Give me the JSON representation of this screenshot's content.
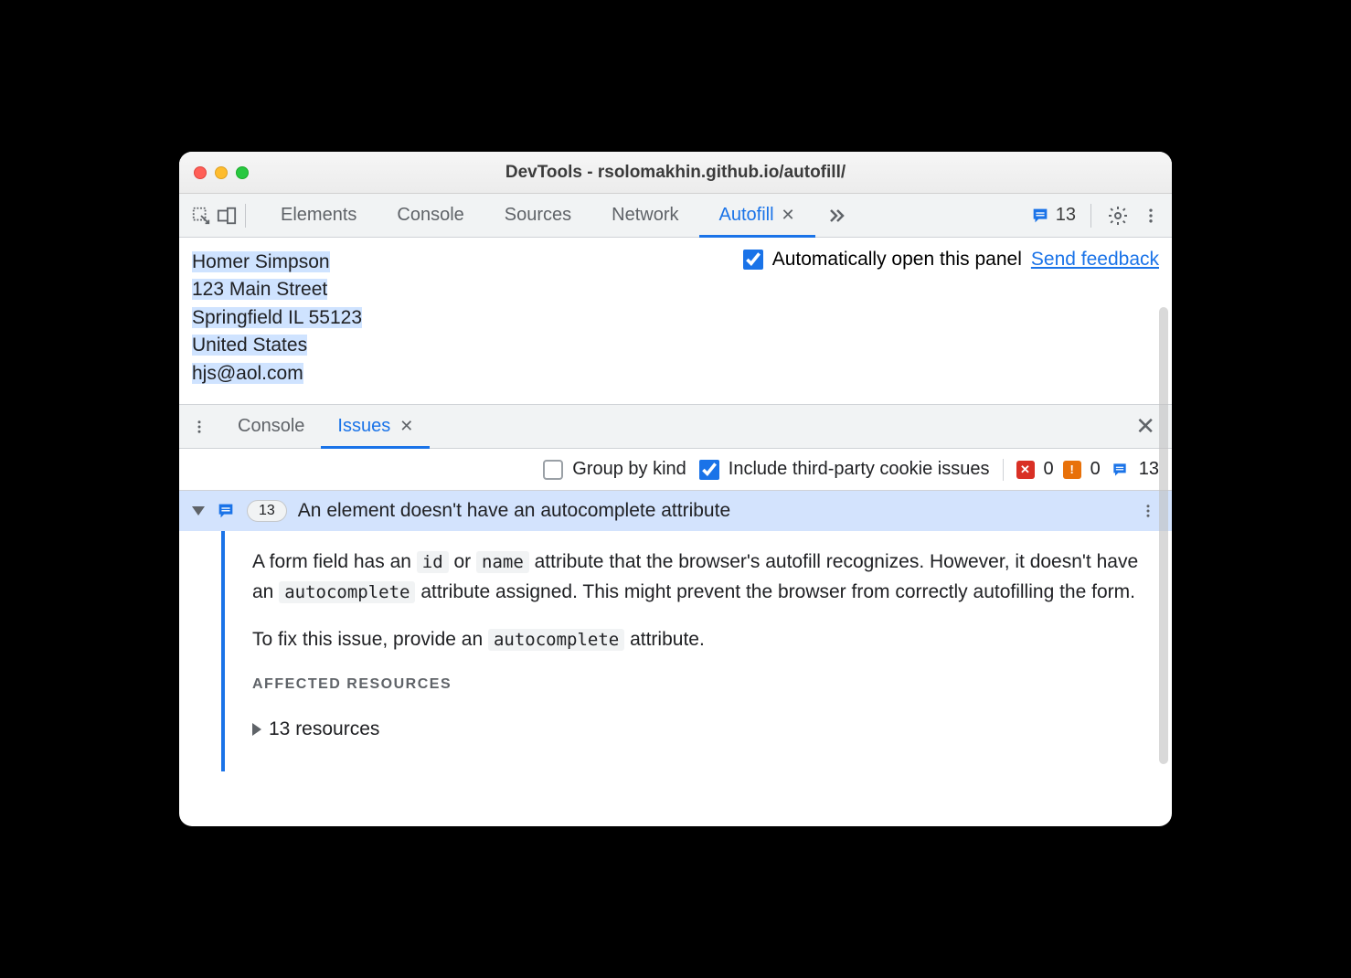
{
  "window": {
    "title": "DevTools - rsolomakhin.github.io/autofill/"
  },
  "toolbar": {
    "tabs": [
      {
        "label": "Elements"
      },
      {
        "label": "Console"
      },
      {
        "label": "Sources"
      },
      {
        "label": "Network"
      },
      {
        "label": "Autofill",
        "active": true,
        "closable": true
      }
    ],
    "issueCount": "13"
  },
  "autofillPanel": {
    "address": {
      "name": "Homer Simpson",
      "street": "123 Main Street",
      "cityLine": "Springfield IL 55123",
      "country": "United States",
      "email": "hjs@aol.com"
    },
    "autoOpenLabel": "Automatically open this panel",
    "feedbackLabel": "Send feedback"
  },
  "drawer": {
    "tabs": [
      {
        "label": "Console"
      },
      {
        "label": "Issues",
        "active": true,
        "closable": true
      }
    ],
    "filters": {
      "groupByKind": "Group by kind",
      "thirdParty": "Include third-party cookie issues"
    },
    "counts": {
      "error": "0",
      "warning": "0",
      "info": "13"
    }
  },
  "issue": {
    "count": "13",
    "title": "An element doesn't have an autocomplete attribute",
    "para1_a": "A form field has an ",
    "code_id": "id",
    "para1_b": " or ",
    "code_name": "name",
    "para1_c": " attribute that the browser's autofill recognizes. However, it doesn't have an ",
    "code_auto1": "autocomplete",
    "para1_d": " attribute assigned. This might prevent the browser from correctly autofilling the form.",
    "para2_a": "To fix this issue, provide an ",
    "code_auto2": "autocomplete",
    "para2_b": " attribute.",
    "affectedHeading": "AFFECTED RESOURCES",
    "resourcesLabel": "13 resources"
  }
}
